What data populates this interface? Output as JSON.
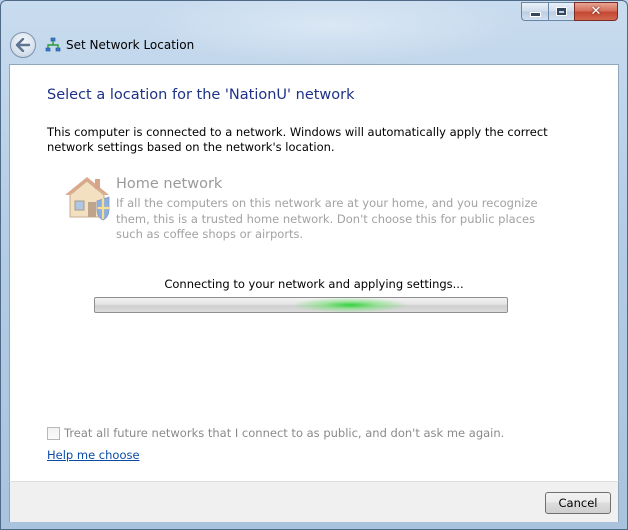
{
  "window": {
    "title": "Set Network Location"
  },
  "heading": "Select a location for the 'NationU' network",
  "description": "This computer is connected to a network. Windows will automatically apply the correct network settings based on the network's location.",
  "option": {
    "title": "Home network",
    "description": "If all the computers on this network are at your home, and you recognize them, this is a trusted home network.  Don't choose this for public places such as coffee shops or airports.",
    "icon": "home-network-icon"
  },
  "status_text": "Connecting to your network and applying settings...",
  "progress": {
    "state": "indeterminate",
    "accent": "#2bd234"
  },
  "checkbox": {
    "label": "Treat all future networks that I connect to as public, and don't ask me again.",
    "checked": false
  },
  "help_link": "Help me choose",
  "footer": {
    "cancel_label": "Cancel"
  },
  "colors": {
    "heading": "#1e3287",
    "link": "#0b4ba8",
    "close_button": "#c44832"
  }
}
